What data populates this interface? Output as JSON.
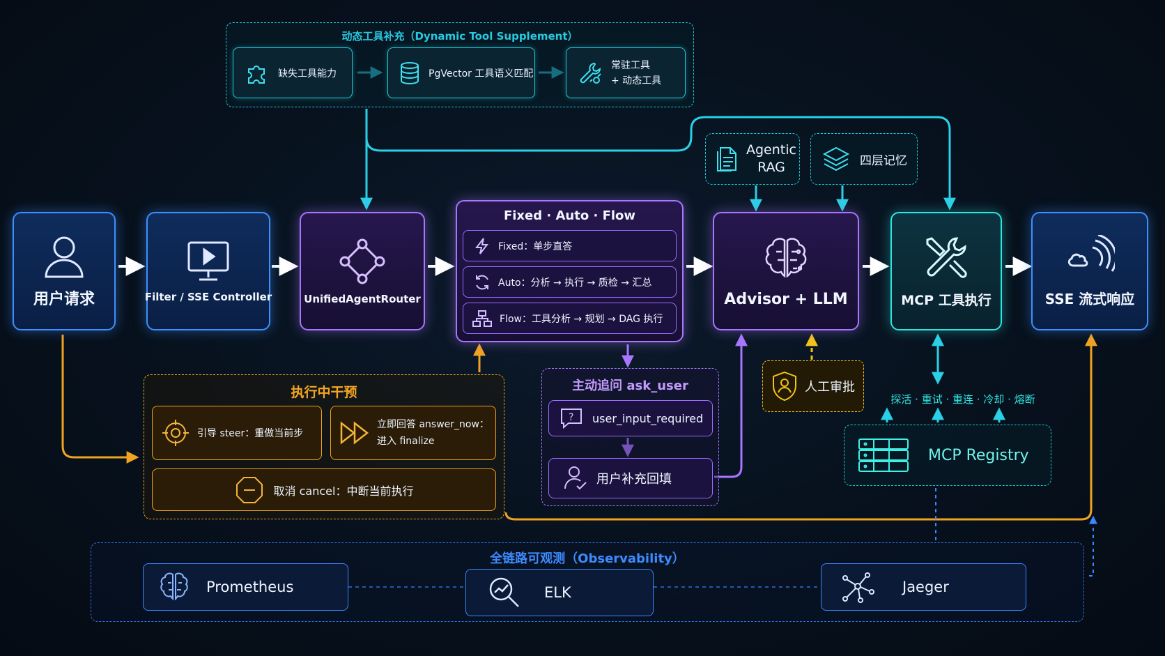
{
  "colors": {
    "teal": "#22c7d6",
    "blue": "#3f8fff",
    "purple": "#a876ff",
    "orange": "#f0a320",
    "yellow": "#f2c21b",
    "text": "#f2f6ff"
  },
  "dynamic_tool": {
    "title": "动态工具补充（Dynamic Tool Supplement）",
    "steps": [
      {
        "label": "缺失工具能力",
        "icon": "puzzle-icon"
      },
      {
        "label": "PgVector 工具语义匹配",
        "icon": "database-icon"
      },
      {
        "label_line1": "常驻工具",
        "label_line2": "+ 动态工具",
        "icon": "tools-icon"
      }
    ]
  },
  "memory": {
    "agentic_rag_line1": "Agentic",
    "agentic_rag_line2": "RAG",
    "four_layer_memory": "四层记忆"
  },
  "pipeline": {
    "user_request": "用户请求",
    "filter": "Filter / SSE Controller",
    "router": "UnifiedAgentRouter",
    "modes": {
      "title": "Fixed · Auto · Flow",
      "fixed": "Fixed：单步直答",
      "auto": "Auto：分析 → 执行 → 质检 → 汇总",
      "flow": "Flow：工具分析 → 规划 → DAG 执行"
    },
    "advisor": "Advisor + LLM",
    "mcp_exec": "MCP 工具执行",
    "sse": "SSE 流式响应"
  },
  "intervention": {
    "title": "执行中干预",
    "steer": "引导 steer：重做当前步",
    "answer_now_line1": "立即回答 answer_now：",
    "answer_now_line2": "进入 finalize",
    "cancel": "取消 cancel：中断当前执行"
  },
  "ask_user": {
    "title": "主动追问 ask_user",
    "input_required": "user_input_required",
    "fill_back": "用户补充回填"
  },
  "approval": "人工审批",
  "mcp_registry": {
    "features": "探活 · 重试 · 重连 · 冷却 · 熔断",
    "label": "MCP Registry"
  },
  "observability": {
    "title": "全链路可观测（Observability）",
    "items": [
      "Prometheus",
      "ELK",
      "Jaeger"
    ]
  }
}
